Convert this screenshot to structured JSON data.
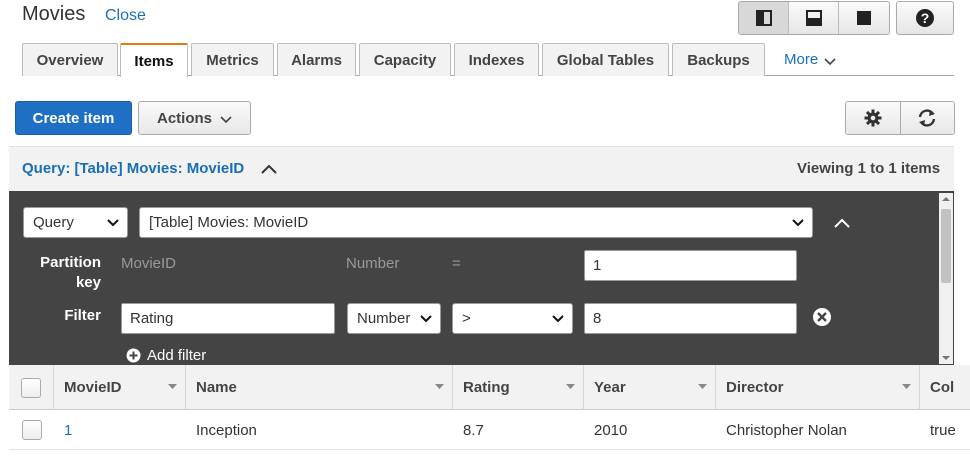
{
  "header": {
    "title": "Movies",
    "close_label": "Close"
  },
  "layout_buttons": [
    "layout-split-vertical-icon",
    "layout-split-horizontal-icon",
    "layout-full-icon"
  ],
  "tabs": [
    {
      "label": "Overview"
    },
    {
      "label": "Items",
      "active": true
    },
    {
      "label": "Metrics"
    },
    {
      "label": "Alarms"
    },
    {
      "label": "Capacity"
    },
    {
      "label": "Indexes"
    },
    {
      "label": "Global Tables"
    },
    {
      "label": "Backups"
    }
  ],
  "more_label": "More",
  "toolbar": {
    "create_label": "Create item",
    "actions_label": "Actions"
  },
  "query": {
    "header_label": "Query: [Table] Movies: MovieID",
    "viewing_text": "Viewing 1 to 1 items",
    "mode_value": "Query",
    "source_value": "[Table] Movies: MovieID",
    "partition_label": "Partition\nkey",
    "partition_key_name": "MovieID",
    "partition_key_type": "Number",
    "partition_operator": "=",
    "partition_value": "1",
    "filter_label": "Filter",
    "filter_attribute": "Rating",
    "filter_type": "Number",
    "filter_operator": ">",
    "filter_value": "8",
    "add_filter_label": "Add filter"
  },
  "table": {
    "columns": [
      "MovieID",
      "Name",
      "Rating",
      "Year",
      "Director",
      "Col"
    ],
    "rows": [
      {
        "MovieID": "1",
        "Name": "Inception",
        "Rating": "8.7",
        "Year": "2010",
        "Director": "Christopher Nolan",
        "Col": "true"
      }
    ]
  },
  "colors": {
    "accent": "#1f6fc5",
    "link": "#1a6fb4",
    "tab_active": "#e47911",
    "panel": "#444444"
  }
}
